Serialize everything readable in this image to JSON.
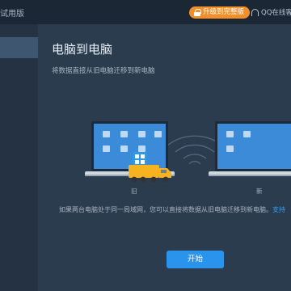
{
  "app": {
    "title": "试用版",
    "upgrade_label": "升级到完整版",
    "qq_label": "QQ在线客服"
  },
  "main": {
    "title": "电脑到电脑",
    "description": "将数据直接从旧电脑迁移到新电脑",
    "old_label": "旧",
    "new_label": "新",
    "note": "如果两台电脑处于同一局域网，您可以直接将数据从旧电脑迁移到新电脑。",
    "note_link": "支持",
    "start_label": "开始"
  },
  "colors": {
    "accent": "#2a93ec",
    "upgrade": "#f1902a",
    "truck": "#f5b320",
    "background": "#2c3c4f"
  },
  "icons": [
    "lock-icon",
    "headset-icon",
    "wifi-signal-icon",
    "truck-icon",
    "folder-icon",
    "music-icon",
    "photo-icon",
    "windows-icon"
  ]
}
